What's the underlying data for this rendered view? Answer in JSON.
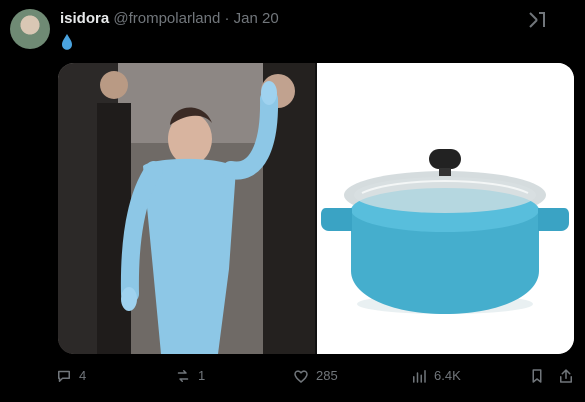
{
  "author": {
    "display_name": "isidora",
    "handle": "@frompolarland",
    "separator": "·",
    "date": "Jan 20"
  },
  "post": {
    "emoji": "💧",
    "media": [
      {
        "label": "woman-in-light-blue-outfit-photo"
      },
      {
        "label": "teal-cooking-pot-photo"
      }
    ]
  },
  "metrics": {
    "replies": "4",
    "reposts": "1",
    "likes": "285",
    "views": "6.4K"
  },
  "icons": {
    "drop": "water-drop-icon",
    "grok": "grok-icon",
    "reply": "reply-icon",
    "repost": "repost-icon",
    "like": "heart-icon",
    "views": "bar-chart-icon",
    "bookmark": "bookmark-icon",
    "share": "share-icon"
  },
  "colors": {
    "background": "#000000",
    "text_primary": "#e7e9ea",
    "text_secondary": "#71767b",
    "drop_blue": "#4aa3df",
    "outfit_blue": "#8dc7e6",
    "pot_teal": "#45aecd"
  }
}
